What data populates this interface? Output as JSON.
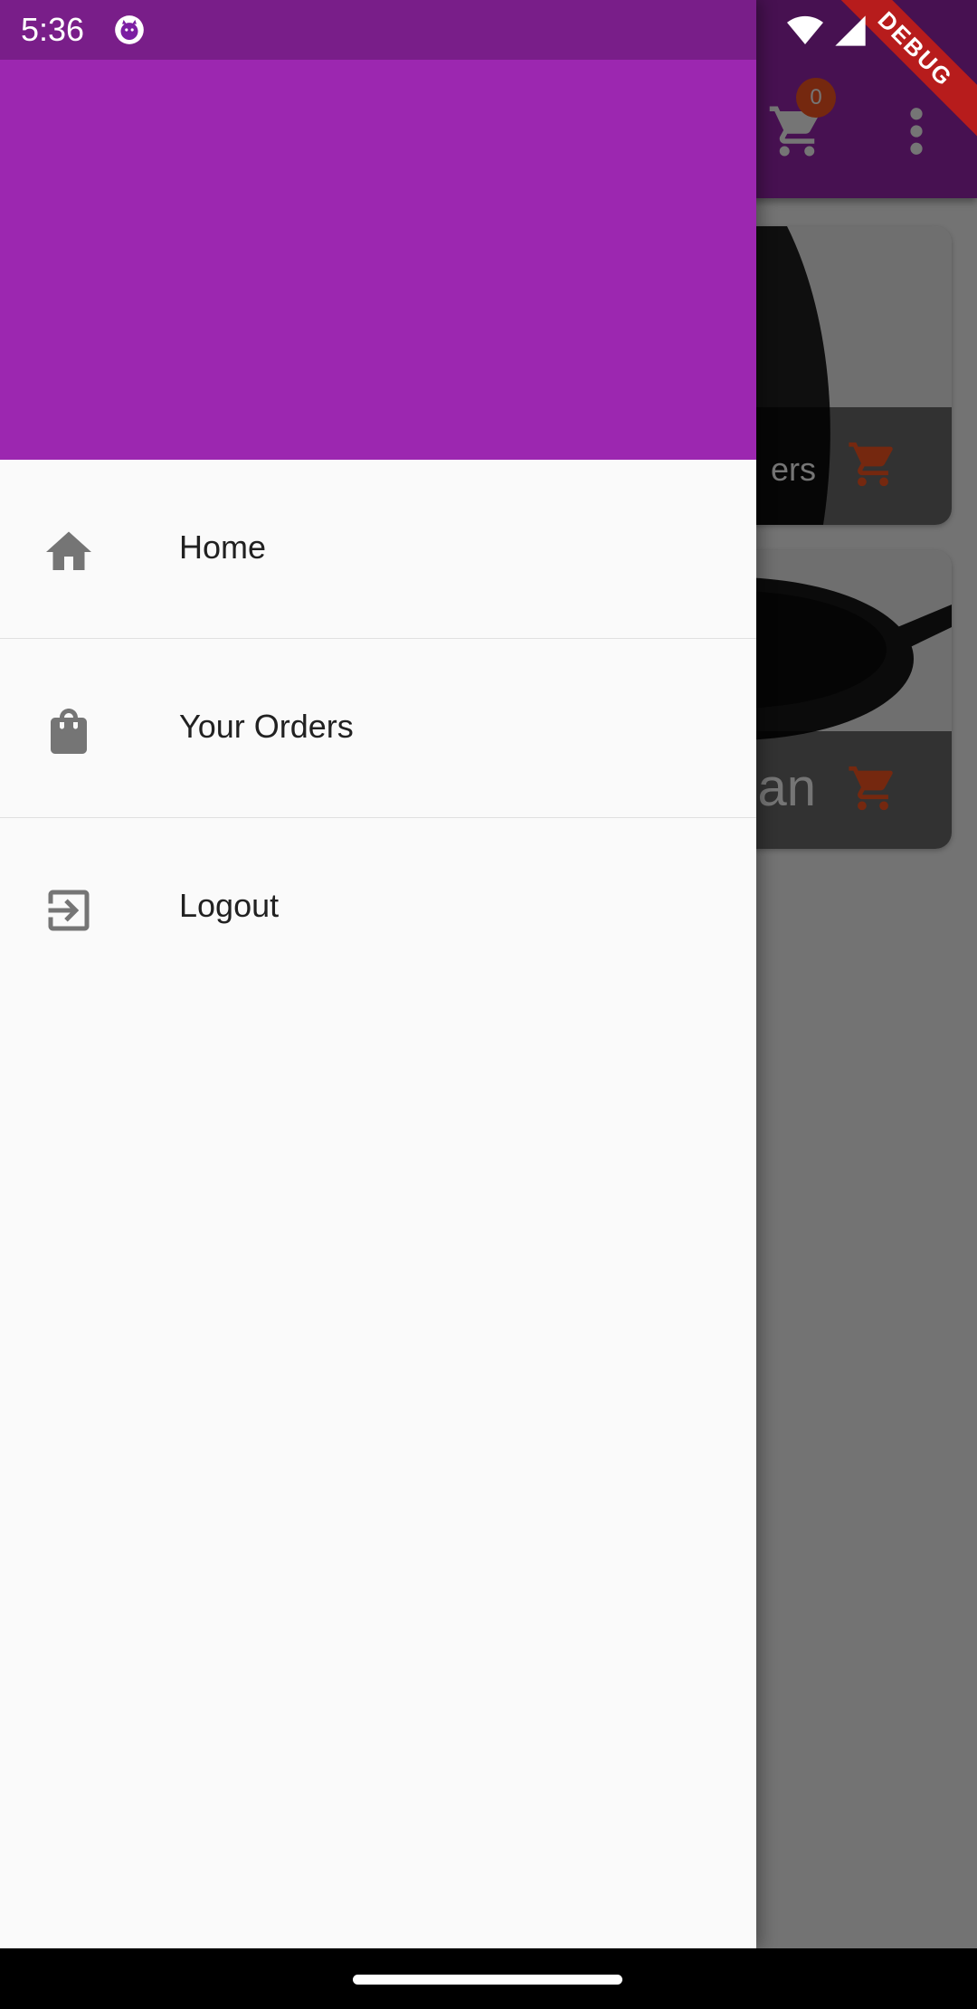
{
  "status_bar": {
    "time": "5:36",
    "icons": [
      "cat-notification-icon",
      "wifi-icon",
      "signal-icon"
    ]
  },
  "debug_banner": {
    "label": "DEBUG"
  },
  "app_bar": {
    "cart_count": "0",
    "actions": [
      "cart-icon",
      "more-vert-icon"
    ]
  },
  "products": [
    {
      "title_partial": "ers"
    },
    {
      "title_partial": "an"
    }
  ],
  "drawer": {
    "menu": [
      {
        "label": "Home",
        "icon": "home-icon"
      },
      {
        "label": "Your Orders",
        "icon": "shopping-bag-icon"
      },
      {
        "label": "Logout",
        "icon": "exit-to-app-icon"
      }
    ]
  },
  "colors": {
    "primary": "#9c27b0",
    "accent": "#ff5722",
    "drawer_bg": "#fafafa",
    "icon_grey": "#757575"
  }
}
